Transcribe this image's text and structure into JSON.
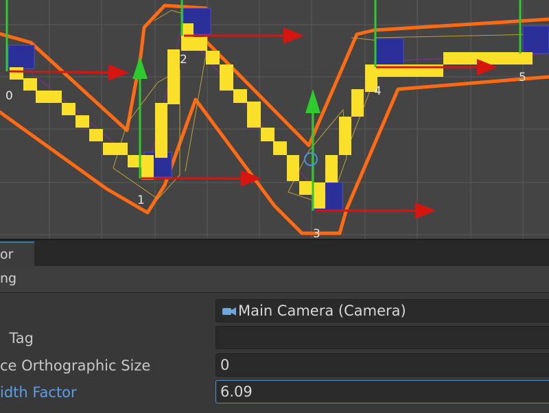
{
  "scene": {
    "point_labels": [
      "0",
      "1",
      "2",
      "3",
      "4",
      "5"
    ]
  },
  "inspector": {
    "tab_label": "or",
    "component_label": "ng",
    "properties": [
      {
        "label": "",
        "value": "Main Camera (Camera)",
        "icon": "camera-icon"
      },
      {
        "label": "Tag",
        "value": ""
      },
      {
        "label": "ce Orthographic Size",
        "value": "0"
      },
      {
        "label": "idth Factor",
        "value": "6.09"
      }
    ]
  },
  "colors": {
    "scene_bg": "#444444",
    "grid_line": "#5a5a5a",
    "outline_orange": "#ff6a13",
    "pixel_yellow": "#fbe02a",
    "axis_x_red": "#d8140f",
    "axis_y_green": "#2ecb2e",
    "handle_blue": "#2a2f9a",
    "focus_blue": "#4d8fd6"
  }
}
